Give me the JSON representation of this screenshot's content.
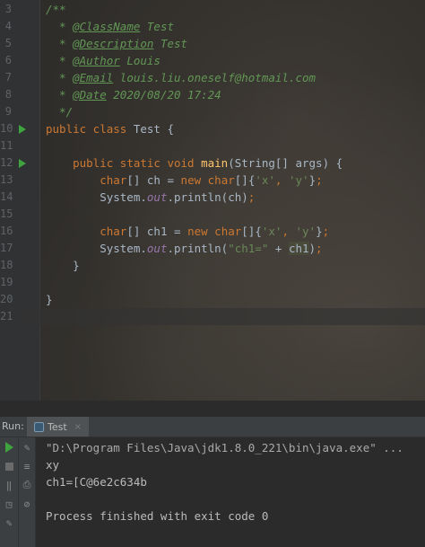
{
  "editor": {
    "lines": [
      {
        "num": "3",
        "tokens": [
          [
            "cm",
            "/**"
          ]
        ]
      },
      {
        "num": "4",
        "tokens": [
          [
            "cm",
            "  * "
          ],
          [
            "tag",
            "@ClassName"
          ],
          [
            "cm",
            " Test"
          ]
        ]
      },
      {
        "num": "5",
        "tokens": [
          [
            "cm",
            "  * "
          ],
          [
            "tag",
            "@Description"
          ],
          [
            "cm",
            " Test"
          ]
        ]
      },
      {
        "num": "6",
        "tokens": [
          [
            "cm",
            "  * "
          ],
          [
            "tag",
            "@Author"
          ],
          [
            "cm",
            " Louis"
          ]
        ]
      },
      {
        "num": "7",
        "tokens": [
          [
            "cm",
            "  * "
          ],
          [
            "tag",
            "@Email"
          ],
          [
            "cm",
            " louis.liu.oneself@hotmail.com"
          ]
        ]
      },
      {
        "num": "8",
        "tokens": [
          [
            "cm",
            "  * "
          ],
          [
            "tag",
            "@Date"
          ],
          [
            "cm",
            " 2020/08/20 17:24"
          ]
        ]
      },
      {
        "num": "9",
        "tokens": [
          [
            "cm",
            "  */"
          ]
        ]
      },
      {
        "num": "10",
        "run": true,
        "tokens": [
          [
            "kw",
            "public class "
          ],
          [
            "pl",
            "Test {"
          ]
        ]
      },
      {
        "num": "11",
        "tokens": []
      },
      {
        "num": "12",
        "run": true,
        "tokens": [
          [
            "pl",
            "    "
          ],
          [
            "kw",
            "public static void "
          ],
          [
            "fn",
            "main"
          ],
          [
            "pl",
            "(String[] args) {"
          ]
        ]
      },
      {
        "num": "13",
        "tokens": [
          [
            "pl",
            "        "
          ],
          [
            "kw",
            "char"
          ],
          [
            "pl",
            "[] ch = "
          ],
          [
            "kw",
            "new char"
          ],
          [
            "pl",
            "[]{"
          ],
          [
            "str",
            "'x'"
          ],
          [
            "kw",
            ", "
          ],
          [
            "str",
            "'y'"
          ],
          [
            "pl",
            "}"
          ],
          [
            "kw",
            ";"
          ]
        ]
      },
      {
        "num": "14",
        "tokens": [
          [
            "pl",
            "        System."
          ],
          [
            "static",
            "out"
          ],
          [
            "pl",
            ".println(ch)"
          ],
          [
            "kw",
            ";"
          ]
        ]
      },
      {
        "num": "15",
        "tokens": []
      },
      {
        "num": "16",
        "tokens": [
          [
            "pl",
            "        "
          ],
          [
            "kw",
            "char"
          ],
          [
            "pl",
            "[] ch1 = "
          ],
          [
            "kw",
            "new char"
          ],
          [
            "pl",
            "[]{"
          ],
          [
            "str",
            "'x'"
          ],
          [
            "kw",
            ", "
          ],
          [
            "str",
            "'y'"
          ],
          [
            "pl",
            "}"
          ],
          [
            "kw",
            ";"
          ]
        ]
      },
      {
        "num": "17",
        "tokens": [
          [
            "pl",
            "        System."
          ],
          [
            "static",
            "out"
          ],
          [
            "pl",
            ".println("
          ],
          [
            "str",
            "\"ch1=\""
          ],
          [
            "pl",
            " + "
          ],
          [
            "hl2",
            "ch1"
          ],
          [
            "pl",
            ")"
          ],
          [
            "kw",
            ";"
          ]
        ]
      },
      {
        "num": "18",
        "tokens": [
          [
            "pl",
            "    }"
          ]
        ]
      },
      {
        "num": "19",
        "tokens": []
      },
      {
        "num": "20",
        "tokens": [
          [
            "pl",
            "}"
          ]
        ]
      },
      {
        "num": "21",
        "current": true,
        "tokens": []
      }
    ]
  },
  "run_panel": {
    "label": "Run:",
    "tab_label": "Test",
    "tab_close": "×",
    "output": [
      {
        "kind": "cmd",
        "text": "\"D:\\Program Files\\Java\\jdk1.8.0_221\\bin\\java.exe\" ..."
      },
      {
        "kind": "out",
        "text": "xy"
      },
      {
        "kind": "out",
        "text": "ch1=[C@6e2c634b"
      },
      {
        "kind": "out",
        "text": ""
      },
      {
        "kind": "out",
        "text": "Process finished with exit code 0"
      }
    ]
  },
  "colors": {
    "keyword": "#cc7832",
    "comment": "#629755",
    "string": "#6a8759",
    "function": "#ffc66d",
    "static_field": "#9876aa",
    "run_green": "#3fa33f"
  }
}
